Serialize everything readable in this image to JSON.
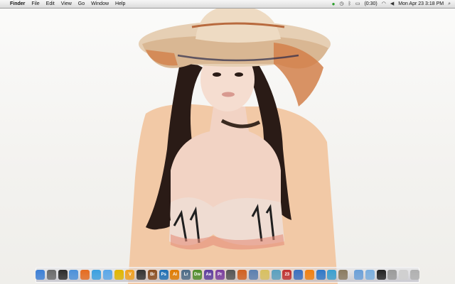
{
  "menubar": {
    "apple_symbol": "",
    "items": [
      "Finder",
      "File",
      "Edit",
      "View",
      "Go",
      "Window",
      "Help"
    ],
    "battery_text": "(0:30)",
    "date_time": "Mon Apr 23  3:18 PM"
  },
  "dock": {
    "apps": [
      {
        "name": "finder-icon",
        "label": "",
        "color": "#3c7fd6"
      },
      {
        "name": "system-preferences-icon",
        "label": "",
        "color": "#6a6a6a"
      },
      {
        "name": "dashboard-icon",
        "label": "",
        "color": "#2b2b2b"
      },
      {
        "name": "preview-icon",
        "label": "",
        "color": "#4a90d9"
      },
      {
        "name": "firefox-icon",
        "label": "",
        "color": "#e56b1f"
      },
      {
        "name": "safari-icon",
        "label": "",
        "color": "#3aa0e0"
      },
      {
        "name": "ichat-icon",
        "label": "",
        "color": "#5aa7e8"
      },
      {
        "name": "adium-icon",
        "label": "",
        "color": "#e0b500"
      },
      {
        "name": "vlc-icon",
        "label": "V",
        "color": "#f0a020"
      },
      {
        "name": "clapper-icon",
        "label": "",
        "color": "#333333"
      },
      {
        "name": "bridge-icon",
        "label": "Br",
        "color": "#8a4d1f"
      },
      {
        "name": "photoshop-icon",
        "label": "Ps",
        "color": "#1e6fb5"
      },
      {
        "name": "illustrator-icon",
        "label": "Ai",
        "color": "#e07b00"
      },
      {
        "name": "lightroom-icon",
        "label": "Lr",
        "color": "#4c6b87"
      },
      {
        "name": "dreamweaver-icon",
        "label": "Dw",
        "color": "#4e8c2a"
      },
      {
        "name": "after-effects-icon",
        "label": "Ae",
        "color": "#5d3e9e"
      },
      {
        "name": "premiere-icon",
        "label": "Pr",
        "color": "#7a3e9e"
      },
      {
        "name": "pen-tool-icon",
        "label": "",
        "color": "#555555"
      },
      {
        "name": "network-icon",
        "label": "",
        "color": "#d06020"
      },
      {
        "name": "script-editor-icon",
        "label": "",
        "color": "#5a7fb0"
      },
      {
        "name": "textedit-icon",
        "label": "",
        "color": "#d8c060"
      },
      {
        "name": "grapher-icon",
        "label": "",
        "color": "#5aa0c0"
      },
      {
        "name": "calendar-icon",
        "label": "23",
        "color": "#c03030"
      },
      {
        "name": "spotlight-icon",
        "label": "",
        "color": "#3a70c0"
      },
      {
        "name": "vlc-cone-icon",
        "label": "",
        "color": "#f08010"
      },
      {
        "name": "itunes-icon",
        "label": "",
        "color": "#2f78c8"
      },
      {
        "name": "time-machine-icon",
        "label": "",
        "color": "#3a9fd0"
      },
      {
        "name": "automator-icon",
        "label": "",
        "color": "#8a7a60"
      }
    ],
    "docs": [
      {
        "name": "applications-folder-icon",
        "label": "",
        "color": "#6a9fd8"
      },
      {
        "name": "documents-folder-icon",
        "label": "",
        "color": "#7aaede"
      },
      {
        "name": "terminal-icon",
        "label": "",
        "color": "#222222"
      },
      {
        "name": "disk-utility-icon",
        "label": "",
        "color": "#9a9a9a"
      },
      {
        "name": "print-icon",
        "label": "",
        "color": "#cfcfcf"
      },
      {
        "name": "trash-icon",
        "label": "",
        "color": "#b0b0b0"
      }
    ]
  }
}
